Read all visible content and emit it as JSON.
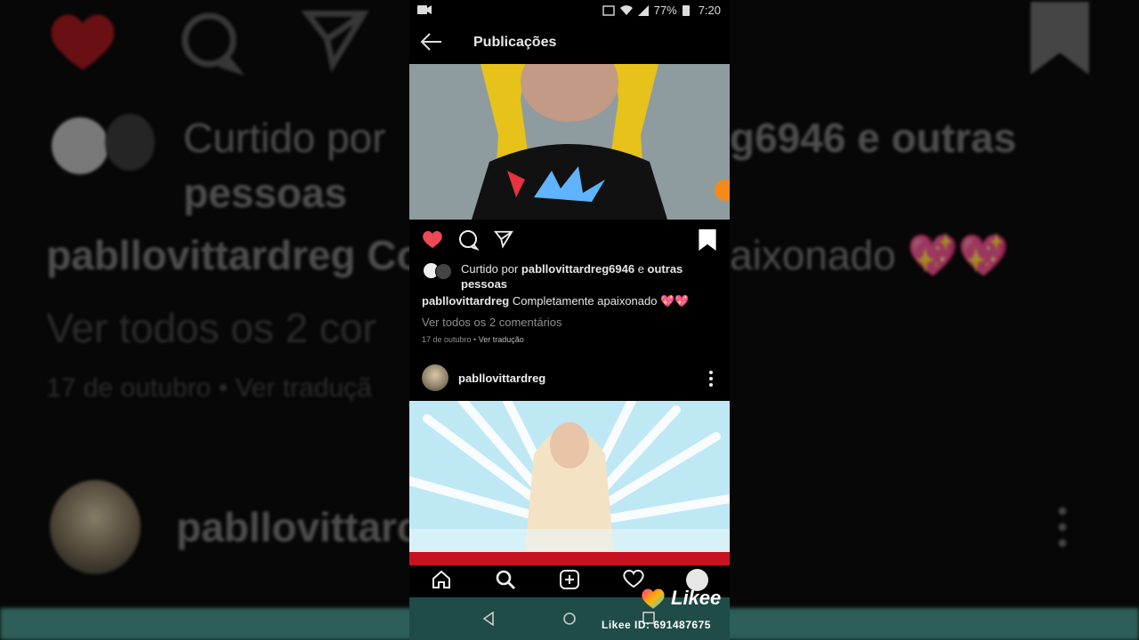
{
  "status_bar": {
    "battery": "77%",
    "time": "7:20"
  },
  "app_bar": {
    "title": "Publicações"
  },
  "post1": {
    "liked_by_prefix": "Curtido por ",
    "liked_by_user": "pabllovittardreg6946",
    "liked_by_suffix": " e ",
    "liked_by_others": "outras pessoas",
    "caption_user": "pabllovittardreg",
    "caption_text": " Completamente apaixonado 💖💖",
    "view_comments": "Ver todos os 2 comentários",
    "date": "17 de outubro",
    "date_separator": " • ",
    "translate": "Ver tradução"
  },
  "post2": {
    "username": "pabllovittardreg"
  },
  "watermark": {
    "brand": "Likee",
    "id": "Likee ID: 691487675"
  },
  "background": {
    "liked_line": "Curtido por",
    "liked_line_end": "g6946 e outras",
    "liked_line2": "pessoas",
    "caption": "pabllovittardreg Cor",
    "caption_end": "aixonado 💖💖",
    "view": "Ver todos os 2 cor",
    "date": "17 de outubro • Ver traduçã",
    "username": "pabllovittarc"
  },
  "colors": {
    "like_red": "#ed4956",
    "nav_bar": "#1f4c46",
    "accent_red": "#c9121f"
  }
}
